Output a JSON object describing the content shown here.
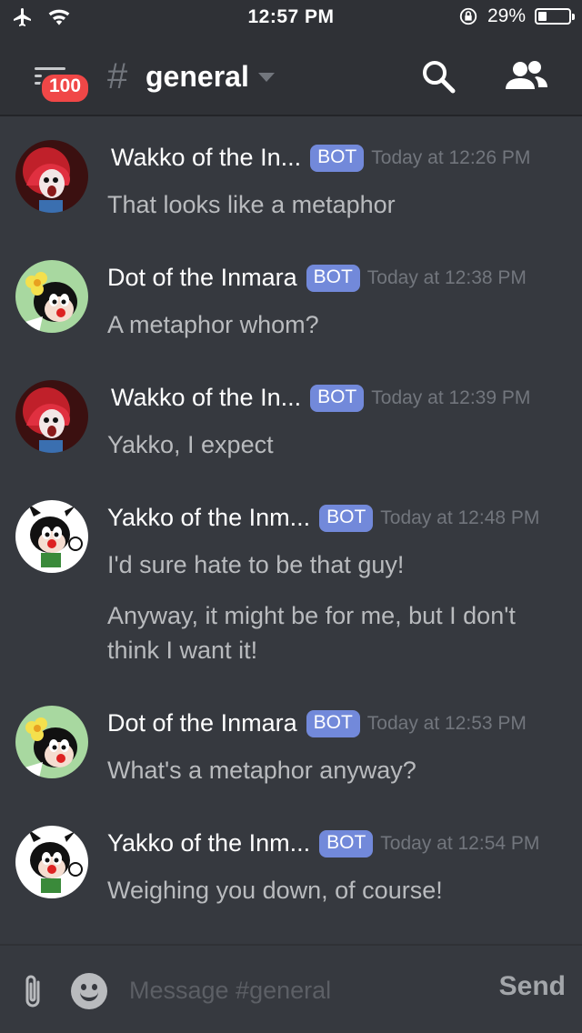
{
  "status_bar": {
    "time": "12:57 PM",
    "battery_percent": "29%",
    "battery_level": 0.29
  },
  "header": {
    "unread_badge": "100",
    "channel_hash": "#",
    "channel_name": "general"
  },
  "messages": [
    {
      "author": "Wakko of the In...",
      "tag": "BOT",
      "timestamp": "Today at 12:26 PM",
      "avatar": "wakko",
      "lines": [
        "That looks like a metaphor"
      ]
    },
    {
      "author": "Dot of the Inmara",
      "tag": "BOT",
      "timestamp": "Today at 12:38 PM",
      "avatar": "dot",
      "lines": [
        "A metaphor whom?"
      ]
    },
    {
      "author": "Wakko of the In...",
      "tag": "BOT",
      "timestamp": "Today at 12:39 PM",
      "avatar": "wakko",
      "lines": [
        "Yakko, I expect"
      ]
    },
    {
      "author": "Yakko of the Inm...",
      "tag": "BOT",
      "timestamp": "Today at 12:48 PM",
      "avatar": "yakko",
      "lines": [
        "I'd sure hate to be that guy!",
        "Anyway, it might be for me, but I don't think I want it!"
      ]
    },
    {
      "author": "Dot of the Inmara",
      "tag": "BOT",
      "timestamp": "Today at 12:53 PM",
      "avatar": "dot",
      "lines": [
        "What's a metaphor anyway?"
      ]
    },
    {
      "author": "Yakko of the Inm...",
      "tag": "BOT",
      "timestamp": "Today at 12:54 PM",
      "avatar": "yakko",
      "lines": [
        "Weighing you down, of course!"
      ]
    }
  ],
  "composer": {
    "placeholder": "Message #general",
    "send_label": "Send"
  },
  "icons": {
    "airplane": "airplane-icon",
    "wifi": "wifi-icon",
    "rotation_lock": "rotation-lock-icon",
    "battery": "battery-icon",
    "menu": "menu-icon",
    "search": "search-icon",
    "members": "members-icon",
    "attach": "paperclip-icon",
    "emoji": "emoji-icon"
  },
  "colors": {
    "background": "#36393f",
    "header": "#2f3136",
    "bot_tag": "#7289da",
    "badge": "#f04747",
    "timestamp": "#72767d"
  }
}
